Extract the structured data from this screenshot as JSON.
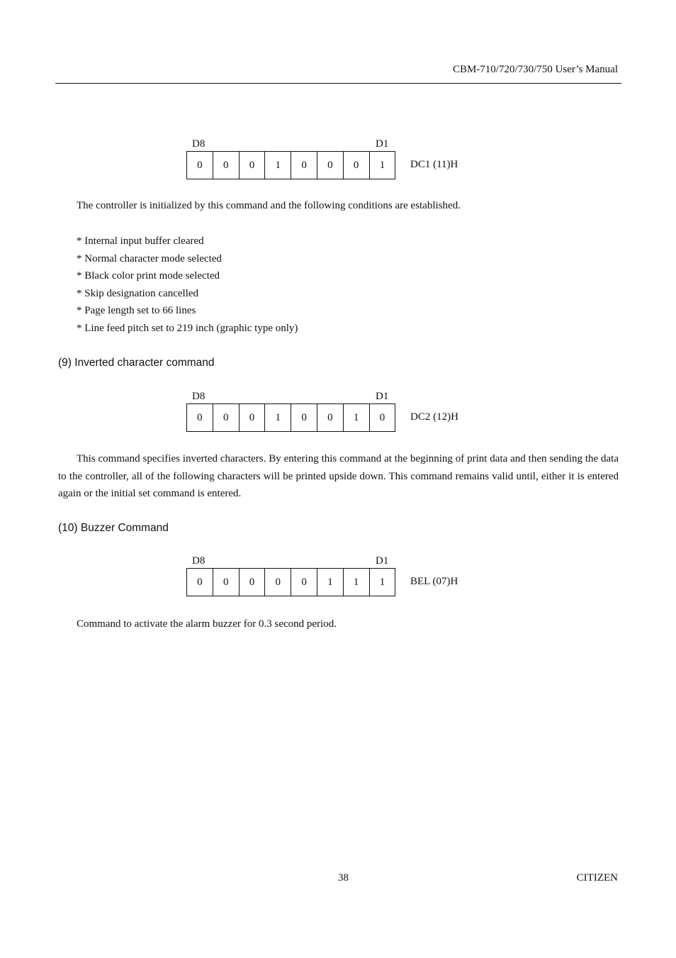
{
  "header": {
    "title": "CBM-710/720/730/750 User’s Manual"
  },
  "sections": {
    "init": {
      "bit_labels": {
        "high": "D8",
        "low": "D1"
      },
      "bits": [
        "0",
        "0",
        "0",
        "1",
        "0",
        "0",
        "0",
        "1"
      ],
      "code": "DC1 (11)H",
      "description": "The controller is initialized by this command and the following conditions are established.",
      "conditions": [
        "* Internal input buffer cleared",
        "* Normal character mode selected",
        "* Black color print mode selected",
        "* Skip designation cancelled",
        "* Page length set to 66 lines",
        "* Line feed pitch set to 219 inch (graphic type only)"
      ]
    },
    "inverted": {
      "heading": "(9) Inverted character command",
      "bit_labels": {
        "high": "D8",
        "low": "D1"
      },
      "bits": [
        "0",
        "0",
        "0",
        "1",
        "0",
        "0",
        "1",
        "0"
      ],
      "code": "DC2 (12)H",
      "description": "This command specifies inverted characters. By entering this command at the beginning of print data and then sending the data to the controller, all of the following characters will be printed upside down. This command remains valid until, either it is entered again or the initial set command is entered."
    },
    "buzzer": {
      "heading": "(10) Buzzer Command",
      "bit_labels": {
        "high": "D8",
        "low": "D1"
      },
      "bits": [
        "0",
        "0",
        "0",
        "0",
        "0",
        "1",
        "1",
        "1"
      ],
      "code": "BEL (07)H",
      "description": "Command to activate the alarm buzzer for 0.3 second period."
    }
  },
  "footer": {
    "page_number": "38",
    "brand": "CITIZEN"
  }
}
